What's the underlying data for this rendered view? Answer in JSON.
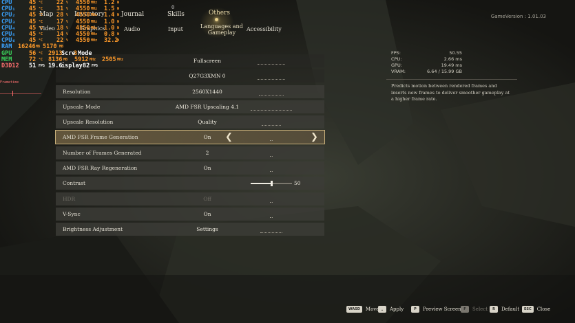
{
  "nav": {
    "tabs_row1": [
      {
        "label": "Map"
      },
      {
        "label": "Inventory"
      },
      {
        "label": "Journal"
      },
      {
        "label": "Skills",
        "badge": "0"
      },
      {
        "label": "Others"
      }
    ],
    "tabs_row2": [
      {
        "label": "Video"
      },
      {
        "label": "Graphics"
      },
      {
        "label": "Audio"
      },
      {
        "label": "Input"
      },
      {
        "label": "Languages and\nGameplay"
      },
      {
        "label": "Accessibility"
      }
    ],
    "game_version": "GameVersion : 1.01.03"
  },
  "osd": {
    "cpu_rows": [
      {
        "name": "CPU",
        "temp": "45",
        "load": "22",
        "clock": "4550",
        "power": "1.2"
      },
      {
        "name": "CPU₁",
        "temp": "45",
        "load": "31",
        "clock": "4550",
        "power": "1.5"
      },
      {
        "name": "CPU₂",
        "temp": "45",
        "load": "28",
        "clock": "4550",
        "power": "1.4"
      },
      {
        "name": "CPU₃",
        "temp": "45",
        "load": "17",
        "clock": "4550",
        "power": "1.0"
      },
      {
        "name": "CPU₄",
        "temp": "45",
        "load": "18",
        "clock": "4550",
        "power": "1.0"
      },
      {
        "name": "CPU₅",
        "temp": "45",
        "load": "14",
        "clock": "4550",
        "power": "0.8"
      },
      {
        "name": "CPU₆",
        "temp": "45",
        "load": "22",
        "clock": "4550",
        "power": "32.2"
      }
    ],
    "ram": {
      "name": "RAM",
      "used": "16246",
      "avail": "5170"
    },
    "gpu": {
      "name": "GPU",
      "temp": "56",
      "clock": "2913",
      "mem": "3"
    },
    "mem": {
      "name": "MEM",
      "temp": "72",
      "used": "8136",
      "clock": "5912",
      "power": "2505"
    },
    "fps": {
      "name": "D3D12",
      "fps": "51",
      "frametime": "19.6",
      "display": "82",
      "sub": "Frametime"
    },
    "overlay_fragments": [
      "Scre",
      "Mode",
      "isplay"
    ]
  },
  "settings": [
    {
      "label": "",
      "value": "Fullscreen"
    },
    {
      "label": "",
      "value": "Q27G3XMN 0"
    },
    {
      "label": "Resolution",
      "value": "2560X1440"
    },
    {
      "label": "Upscale Mode",
      "value": "AMD FSR Upscaling 4.1"
    },
    {
      "label": "Upscale Resolution",
      "value": "Quality"
    },
    {
      "label": "AMD FSR Frame Generation",
      "value": "On",
      "selected": true
    },
    {
      "label": "Number of Frames Generated",
      "value": "2"
    },
    {
      "label": "AMD FSR Ray Regeneration",
      "value": "On"
    },
    {
      "label": "Contrast",
      "value": "50",
      "slider": 0.5
    },
    {
      "label": "HDR",
      "value": "Off",
      "disabled": true
    },
    {
      "label": "V-Sync",
      "value": "On"
    },
    {
      "label": "Brightness Adjustment",
      "value": "Settings"
    }
  ],
  "info": {
    "stats": [
      {
        "key": "FPS:",
        "value": "50.55"
      },
      {
        "key": "CPU:",
        "value": "2.66  ms"
      },
      {
        "key": "GPU:",
        "value": "19.49  ms"
      },
      {
        "key": "VRAM:",
        "value": "6.64  /  15.99  GB"
      }
    ],
    "description": "Predicts motion between rendered frames and inserts new frames to deliver smoother gameplay at a higher frame rate."
  },
  "hints": [
    {
      "key": "WASD",
      "label": "Move"
    },
    {
      "key": "⎵",
      "label": "Apply"
    },
    {
      "key": "P",
      "label": "Preview Screen"
    },
    {
      "key": "F",
      "label": "Select",
      "dim": true
    },
    {
      "key": "R",
      "label": "Default"
    },
    {
      "key": "ESC",
      "label": "Close"
    }
  ]
}
